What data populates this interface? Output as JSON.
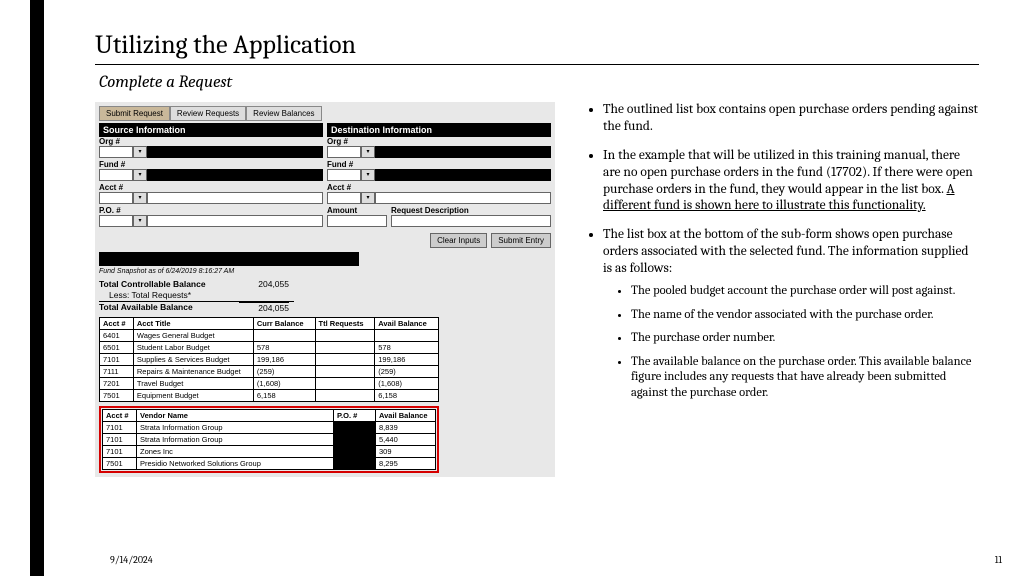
{
  "slide": {
    "title": "Utilizing the Application",
    "subtitle": "Complete a Request"
  },
  "app": {
    "tabs": [
      "Submit Request",
      "Review Requests",
      "Review Balances"
    ],
    "source_hdr": "Source Information",
    "dest_hdr": "Destination Information",
    "labels": {
      "org": "Org #",
      "fund": "Fund #",
      "acct": "Acct #",
      "po": "P.O. #",
      "amount": "Amount",
      "reqdesc": "Request Description"
    },
    "buttons": {
      "clear": "Clear Inputs",
      "submit": "Submit Entry"
    },
    "snapshot": "Fund Snapshot as of 6/24/2019 8:16:27 AM",
    "balances": {
      "tcb_label": "Total Controllable Balance",
      "tcb_val": "204,055",
      "less_label": "Less: Total Requests*",
      "less_val": "",
      "tab_label": "Total Available Balance",
      "tab_val": "204,055"
    },
    "acct_table": {
      "headers": [
        "Acct #",
        "Acct Title",
        "Curr Balance",
        "Ttl Requests",
        "Avail Balance"
      ],
      "rows": [
        [
          "6401",
          "Wages General Budget",
          "",
          "",
          ""
        ],
        [
          "6501",
          "Student Labor Budget",
          "578",
          "",
          "578"
        ],
        [
          "7101",
          "Supplies & Services Budget",
          "199,186",
          "",
          "199,186"
        ],
        [
          "7111",
          "Repairs & Maintenance Budget",
          "(259)",
          "",
          "(259)"
        ],
        [
          "7201",
          "Travel Budget",
          "(1,608)",
          "",
          "(1,608)"
        ],
        [
          "7501",
          "Equipment Budget",
          "6,158",
          "",
          "6,158"
        ]
      ]
    },
    "po_table": {
      "headers": [
        "Acct #",
        "Vendor Name",
        "P.O. #",
        "Avail Balance"
      ],
      "rows": [
        [
          "7101",
          "Strata Information Group",
          "",
          "8,839"
        ],
        [
          "7101",
          "Strata Information Group",
          "",
          "5,440"
        ],
        [
          "7101",
          "Zones Inc",
          "",
          "309"
        ],
        [
          "7501",
          "Presidio Networked Solutions Group",
          "",
          "8,295"
        ]
      ]
    }
  },
  "bullets": {
    "b1": "The outlined list box contains open purchase orders pending against the fund.",
    "b2a": "In the example that will be utilized in this training manual, there are no open purchase orders in the fund (17702). If there were open purchase orders in the fund, they would appear in the list box. ",
    "b2u": "A different fund is shown here to illustrate this functionality.",
    "b3": "The list box at the bottom of the sub-form shows open purchase orders associated with the selected fund. The information supplied is as follows:",
    "s1": "The pooled budget account the purchase order will post against.",
    "s2": "The name of the vendor associated with the purchase order.",
    "s3": "The purchase order number.",
    "s4": "The available balance on the purchase order. This available balance figure includes any requests that have already been submitted against the purchase order."
  },
  "footer": {
    "date": "9/14/2024",
    "page": "11"
  }
}
